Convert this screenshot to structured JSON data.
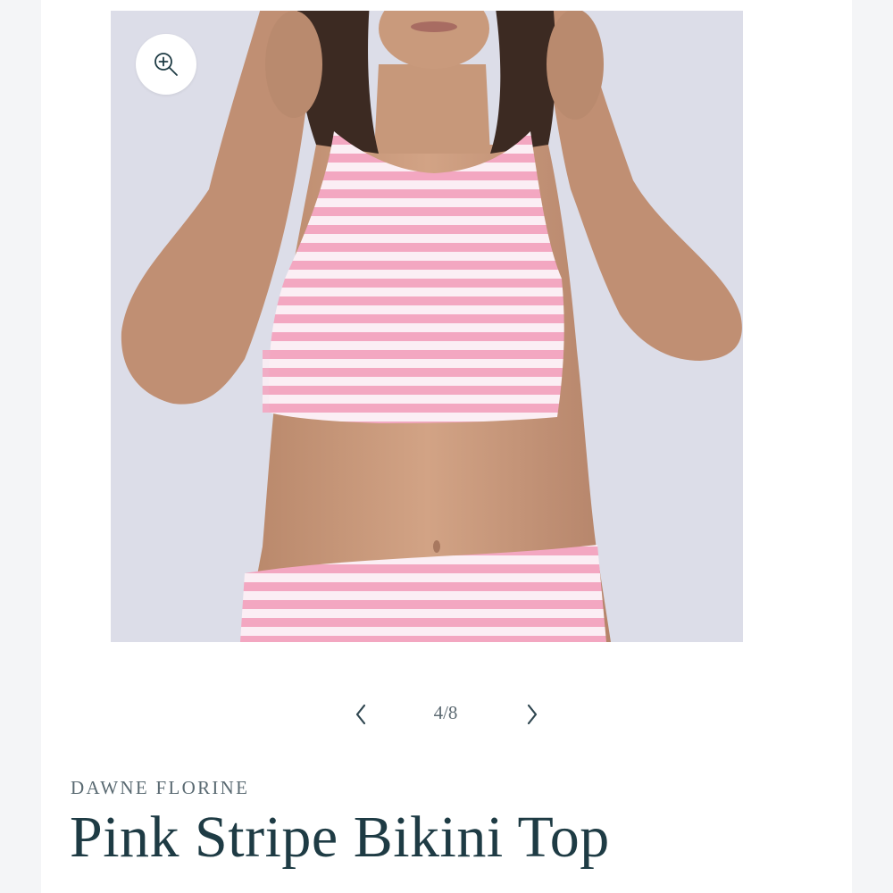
{
  "gallery": {
    "zoom_icon": "zoom-in-icon",
    "current": 4,
    "total": 8,
    "counter_label": "4/8",
    "prev_icon": "chevron-left-icon",
    "next_icon": "chevron-right-icon",
    "colors": {
      "top_stripe_pink": "#f3a7c1",
      "stripe_white": "#fbeef4",
      "backdrop": "#dcdde8",
      "skin": "#c99a7c",
      "hair": "#3c2a22"
    }
  },
  "product": {
    "vendor": "DAWNE FLORINE",
    "title": "Pink Stripe Bikini Top"
  }
}
